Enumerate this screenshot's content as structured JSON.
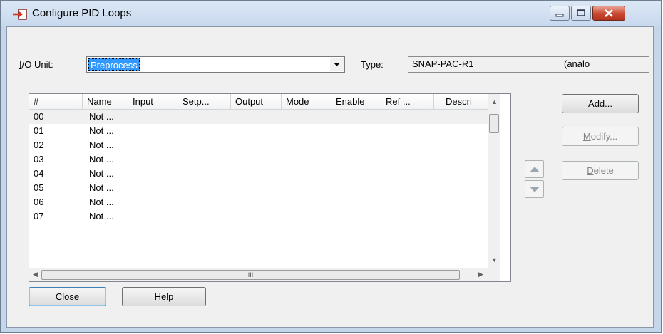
{
  "window": {
    "title": "Configure PID Loops"
  },
  "io_unit": {
    "label_key": "I",
    "label_rest": "/O Unit:",
    "value": "Preprocess"
  },
  "type_field": {
    "label": "Type:",
    "value": "SNAP-PAC-R1",
    "extra": "(analo"
  },
  "table": {
    "columns": [
      "#",
      "Name",
      "Input",
      "Setp...",
      "Output",
      "Mode",
      "Enable",
      "Ref ...",
      "Descri"
    ],
    "rows": [
      {
        "num": "00",
        "name": "Not ..."
      },
      {
        "num": "01",
        "name": "Not ..."
      },
      {
        "num": "02",
        "name": "Not ..."
      },
      {
        "num": "03",
        "name": "Not ..."
      },
      {
        "num": "04",
        "name": "Not ..."
      },
      {
        "num": "05",
        "name": "Not ..."
      },
      {
        "num": "06",
        "name": "Not ..."
      },
      {
        "num": "07",
        "name": "Not ..."
      }
    ],
    "hscroll_grip": "III"
  },
  "buttons": {
    "add": {
      "key": "A",
      "rest": "dd..."
    },
    "modify": {
      "key": "M",
      "rest": "odify..."
    },
    "delete": {
      "key": "D",
      "rest": "elete"
    },
    "close": "Close",
    "help": {
      "key": "H",
      "rest": "elp"
    }
  },
  "colors": {
    "selection": "#3399ff",
    "title_bg": "#c8d9ee",
    "close_red": "#c9462f"
  }
}
